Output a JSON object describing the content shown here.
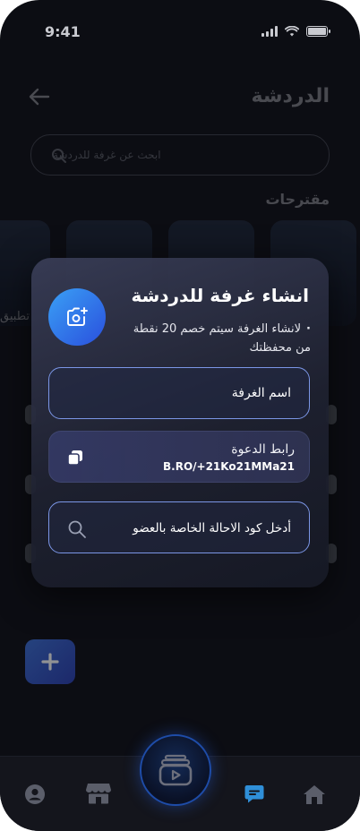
{
  "status_bar": {
    "time": "9:41"
  },
  "background": {
    "title": "الدردشة",
    "search_placeholder": "ابحث عن غرفة للدردشة",
    "suggestions_label": "مقترحات",
    "thumb_caption": "تطبيق"
  },
  "modal": {
    "title": "انشاء غرفة للدردشة",
    "note_bullet": "·",
    "note": "لانشاء الغرفة سيتم خصم 20 نقطة من محفظتك",
    "room_name_placeholder": "اسم الغرفة",
    "invite": {
      "label": "رابط الدعوة",
      "link": "B.RO/+21Ko21MMa21"
    },
    "referral_placeholder": "أدخل كود الاحالة الخاصة بالعضو"
  },
  "bottom_nav": {
    "items": [
      "profile-icon",
      "store-icon",
      "reels-icon",
      "chat-icon",
      "home-icon"
    ],
    "active": "chat-icon",
    "accent": "#2f8fd8"
  },
  "colors": {
    "accent": "#2a6fe0",
    "background": "#0c0d13"
  }
}
